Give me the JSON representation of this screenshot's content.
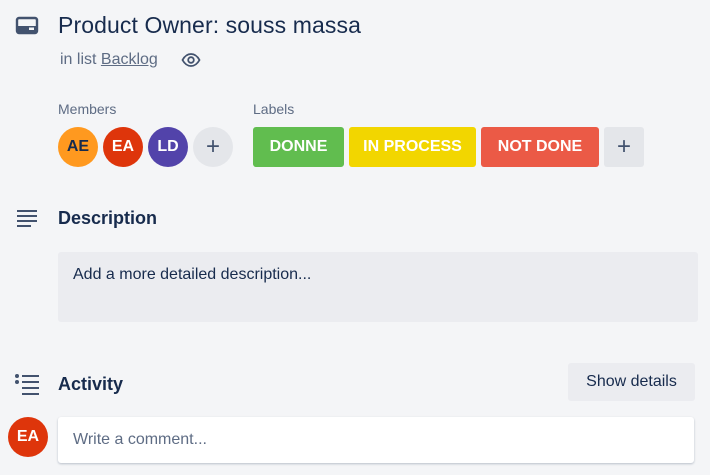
{
  "card": {
    "title": "Product Owner: souss massa",
    "in_list_prefix": "in list",
    "list_name": "Backlog"
  },
  "members": {
    "label": "Members",
    "avatars": [
      {
        "initials": "AE",
        "color": "#ff991f"
      },
      {
        "initials": "EA",
        "color": "#de350b"
      },
      {
        "initials": "LD",
        "color": "#5243aa"
      }
    ],
    "add_label": "+"
  },
  "labels": {
    "label": "Labels",
    "items": [
      {
        "text": "DONNE",
        "color": "#61bd4f"
      },
      {
        "text": "IN PROCESS",
        "color": "#f2d600"
      },
      {
        "text": "NOT DONE",
        "color": "#eb5a46"
      }
    ],
    "add_label": "+"
  },
  "description": {
    "title": "Description",
    "placeholder": "Add a more detailed description..."
  },
  "activity": {
    "title": "Activity",
    "show_details_label": "Show details",
    "current_user_initials": "EA",
    "comment_placeholder": "Write a comment..."
  },
  "icons": {
    "card": "card-icon",
    "watch": "eye-icon",
    "description": "description-icon",
    "activity": "activity-list-icon"
  }
}
